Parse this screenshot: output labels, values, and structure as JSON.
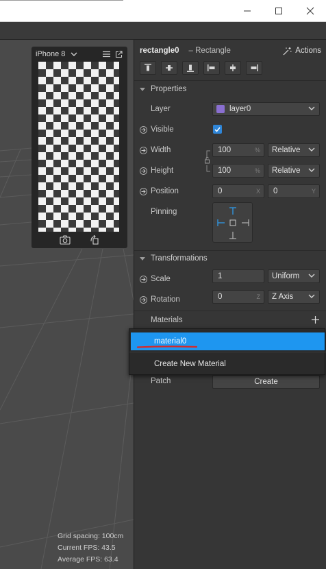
{
  "window": {
    "minimize_icon": "minimize-icon",
    "maximize_icon": "maximize-icon",
    "close_icon": "close-icon"
  },
  "viewport": {
    "device_name": "iPhone 8",
    "stats": {
      "grid_spacing": "Grid spacing: 100cm",
      "current_fps": "Current FPS:  43.5",
      "average_fps": "Average FPS: 63.4"
    }
  },
  "inspector": {
    "object_name": "rectangle0",
    "object_type": "– Rectangle",
    "actions_label": "Actions",
    "properties": {
      "header": "Properties",
      "layer_label": "Layer",
      "layer_value": "layer0",
      "layer_color": "#8a6fd1",
      "visible_label": "Visible",
      "visible_checked": true,
      "width_label": "Width",
      "width_value": "100",
      "width_unit": "%",
      "width_mode": "Relative",
      "height_label": "Height",
      "height_value": "100",
      "height_unit": "%",
      "height_mode": "Relative",
      "position_label": "Position",
      "position_x": "0",
      "position_x_axis": "X",
      "position_y": "0",
      "position_y_axis": "Y",
      "pinning_label": "Pinning"
    },
    "transformations": {
      "header": "Transformations",
      "scale_label": "Scale",
      "scale_value": "1",
      "scale_mode": "Uniform",
      "rotation_label": "Rotation",
      "rotation_value": "0",
      "rotation_axis_letter": "Z",
      "rotation_axis": "Z Axis"
    },
    "materials": {
      "label": "Materials",
      "patch_label": "Patch",
      "create_button": "Create"
    }
  },
  "material_menu": {
    "selected_item": "material0",
    "create_item": "Create New Material"
  },
  "colors": {
    "accent": "#1e96f0",
    "checkbox": "#2f86d8",
    "underline": "#d42a2a"
  }
}
